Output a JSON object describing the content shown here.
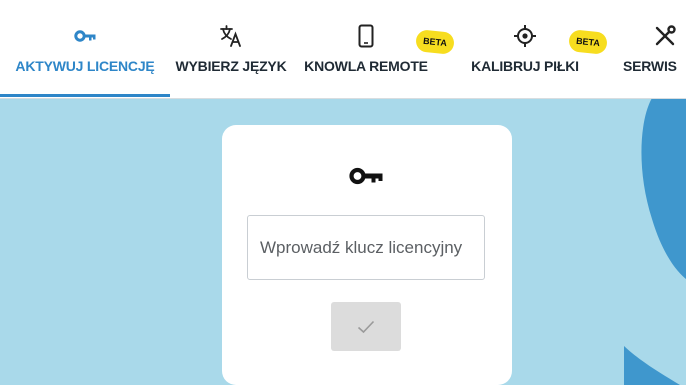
{
  "tabs": [
    {
      "label": "AKTYWUJ LICENCJĘ",
      "icon": "key-icon",
      "active": true
    },
    {
      "label": "WYBIERZ JĘZYK",
      "icon": "translate-icon"
    },
    {
      "label": "KNOWLA REMOTE",
      "icon": "smartphone-icon",
      "badge": "BETA"
    },
    {
      "label": "KALIBRUJ PIŁKI",
      "icon": "crosshair-icon",
      "badge": "BETA"
    },
    {
      "label": "SERWIS",
      "icon": "tools-icon"
    }
  ],
  "license": {
    "placeholder": "Wprowadź klucz licencyjny",
    "submit_icon": "checkmark-icon",
    "icon": "key-icon"
  },
  "colors": {
    "accent": "#2e86c8",
    "background": "#a9d9ea",
    "shape": "#3f97cd",
    "badge": "#f7dd1f"
  }
}
